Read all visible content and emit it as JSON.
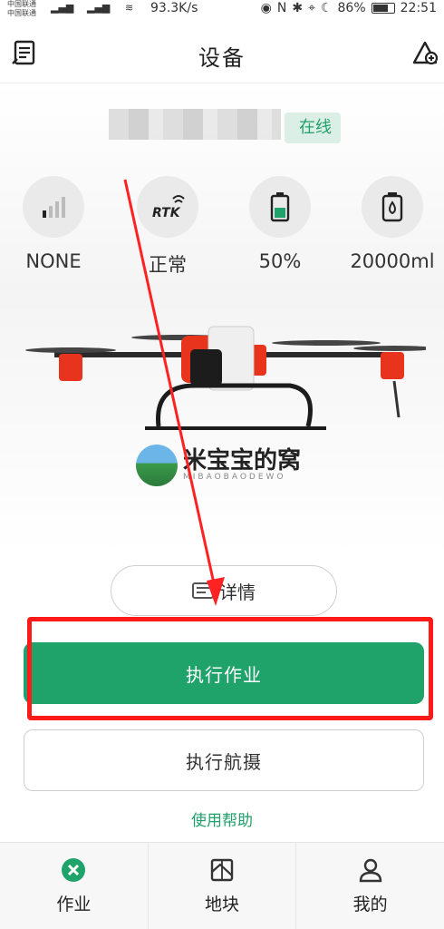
{
  "status_bar": {
    "carrier_1": "中国联通",
    "carrier_2": "中国联通",
    "net_speed": "93.3K/s",
    "battery": "86%",
    "time": "22:51"
  },
  "header": {
    "title": "设备"
  },
  "device": {
    "status_badge": "在线",
    "stats": [
      {
        "icon": "signal-icon",
        "value": "NONE"
      },
      {
        "icon": "rtk-icon",
        "value": "正常"
      },
      {
        "icon": "battery-icon",
        "value": "50%"
      },
      {
        "icon": "tank-icon",
        "value": "20000ml"
      }
    ]
  },
  "watermark": {
    "text": "米宝宝的窝",
    "sub": "MIBAOBAODEWO"
  },
  "actions": {
    "detail_label": "详情",
    "execute_label": "执行作业",
    "aerial_label": "执行航摄",
    "help_label": "使用帮助"
  },
  "bottom_nav": {
    "items": [
      {
        "label": "作业",
        "icon": "work-icon"
      },
      {
        "label": "地块",
        "icon": "field-icon"
      },
      {
        "label": "我的",
        "icon": "profile-icon"
      }
    ]
  },
  "colors": {
    "accent": "#1fa36b",
    "highlight": "#ff1a1a"
  }
}
